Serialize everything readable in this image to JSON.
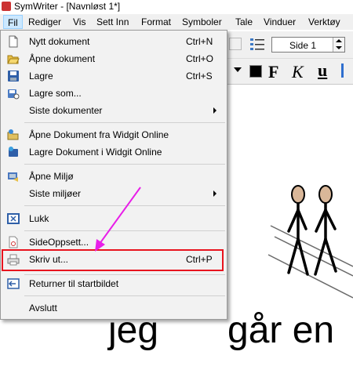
{
  "window": {
    "title": "SymWriter - [Navnløst 1*]"
  },
  "menubar": {
    "items": [
      {
        "label": "Fil"
      },
      {
        "label": "Rediger"
      },
      {
        "label": "Vis"
      },
      {
        "label": "Sett Inn"
      },
      {
        "label": "Format"
      },
      {
        "label": "Symboler"
      },
      {
        "label": "Tale"
      },
      {
        "label": "Vinduer"
      },
      {
        "label": "Verktøy"
      }
    ]
  },
  "toolbar": {
    "page_select": "Side 1",
    "bold": "F",
    "italic": "K",
    "underline": "u"
  },
  "file_menu": {
    "items": [
      {
        "label": "Nytt dokument",
        "shortcut": "Ctrl+N",
        "icon": "new-document-icon"
      },
      {
        "label": "Åpne dokument",
        "shortcut": "Ctrl+O",
        "icon": "open-folder-icon"
      },
      {
        "label": "Lagre",
        "shortcut": "Ctrl+S",
        "icon": "save-disk-icon"
      },
      {
        "label": "Lagre som...",
        "shortcut": "",
        "icon": "save-as-icon"
      },
      {
        "label": "Siste dokumenter",
        "shortcut": "",
        "icon": ""
      },
      {
        "label": "Åpne Dokument fra Widgit Online",
        "shortcut": "",
        "icon": "open-online-icon"
      },
      {
        "label": "Lagre Dokument i Widgit Online",
        "shortcut": "",
        "icon": "save-online-icon"
      },
      {
        "label": "Åpne Miljø",
        "shortcut": "",
        "icon": "open-environment-icon"
      },
      {
        "label": "Siste miljøer",
        "shortcut": "",
        "icon": ""
      },
      {
        "label": "Lukk",
        "shortcut": "",
        "icon": "close-window-icon"
      },
      {
        "label": "SideOppsett...",
        "shortcut": "",
        "icon": "page-setup-icon"
      },
      {
        "label": "Skriv ut...",
        "shortcut": "Ctrl+P",
        "icon": "printer-icon"
      },
      {
        "label": "Returner til startbildet",
        "shortcut": "",
        "icon": "return-start-icon"
      },
      {
        "label": "Avslutt",
        "shortcut": "",
        "icon": ""
      }
    ]
  },
  "document": {
    "words": [
      "jeg",
      "går en"
    ]
  },
  "colors": {
    "menu_bg": "#f2f2f2",
    "highlight": "#e8141e",
    "annotation_arrow": "#e81ee8",
    "menubar_active": "#cce8ff"
  }
}
